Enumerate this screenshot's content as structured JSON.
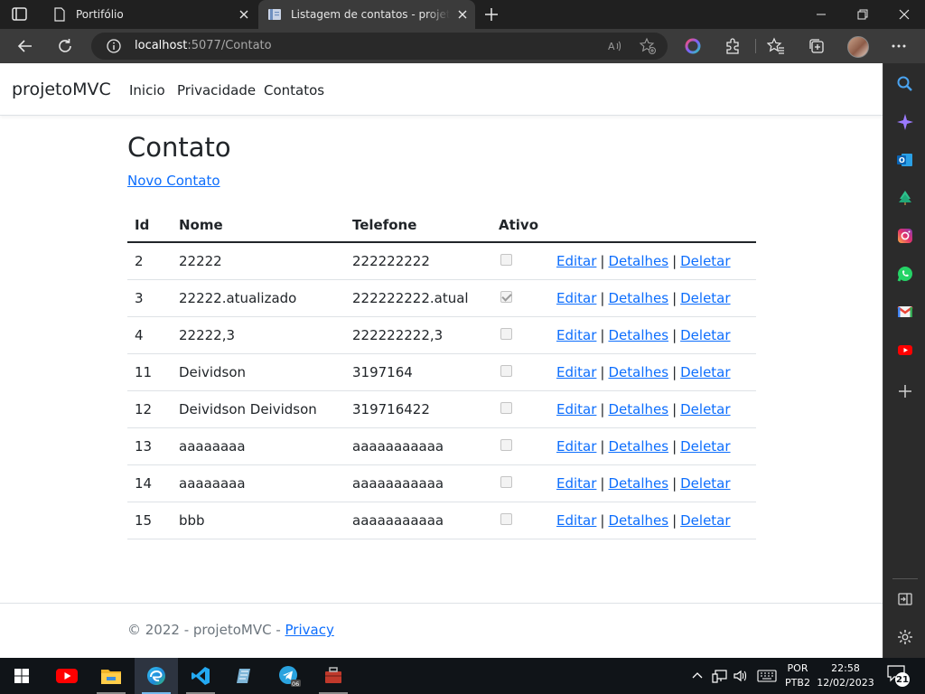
{
  "browser": {
    "tabs": [
      {
        "title": "Portifólio"
      },
      {
        "title": "Listagem de contatos - projetoMVC"
      }
    ],
    "url_host": "localhost",
    "url_rest": ":5077/Contato"
  },
  "page": {
    "brand": "projetoMVC",
    "nav": [
      "Inicio",
      "Privacidade",
      "Contatos"
    ],
    "title": "Contato",
    "new_link": "Novo Contato",
    "table": {
      "headers": [
        "Id",
        "Nome",
        "Telefone",
        "Ativo"
      ],
      "rows": [
        {
          "id": "2",
          "nome": "22222",
          "telefone": "222222222",
          "ativo": false
        },
        {
          "id": "3",
          "nome": "22222.atualizado",
          "telefone": "222222222.atual",
          "ativo": true
        },
        {
          "id": "4",
          "nome": "22222,3",
          "telefone": "222222222,3",
          "ativo": false
        },
        {
          "id": "11",
          "nome": "Deividson",
          "telefone": "3197164",
          "ativo": false
        },
        {
          "id": "12",
          "nome": "Deividson Deividson",
          "telefone": "319716422",
          "ativo": false
        },
        {
          "id": "13",
          "nome": "aaaaaaaa",
          "telefone": "aaaaaaaaaaa",
          "ativo": false
        },
        {
          "id": "14",
          "nome": "aaaaaaaa",
          "telefone": "aaaaaaaaaaa",
          "ativo": false
        },
        {
          "id": "15",
          "nome": "bbb",
          "telefone": "aaaaaaaaaaa",
          "ativo": false
        }
      ],
      "actions": [
        "Editar",
        "Detalhes",
        "Deletar"
      ],
      "separator": "|"
    },
    "footer": {
      "text": "© 2022 - projetoMVC - ",
      "link": "Privacy"
    }
  },
  "taskbar": {
    "lang_top": "POR",
    "lang_bottom": "PTB2",
    "time": "22:58",
    "date": "12/02/2023",
    "notification_count": "21",
    "telegram_badge": "06"
  },
  "colors": {
    "link": "#0d6efd",
    "tab_active": "#3b3b3b",
    "chrome_bg": "#202020",
    "taskbar_bg": "#101418"
  }
}
